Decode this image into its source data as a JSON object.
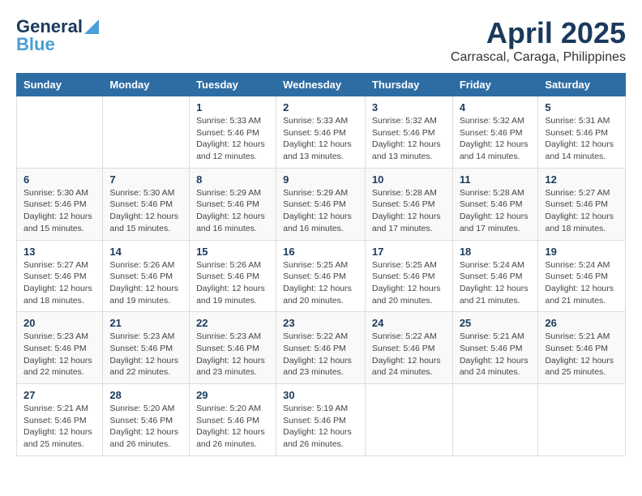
{
  "header": {
    "logo_line1": "General",
    "logo_line2": "Blue",
    "month": "April 2025",
    "location": "Carrascal, Caraga, Philippines"
  },
  "weekdays": [
    "Sunday",
    "Monday",
    "Tuesday",
    "Wednesday",
    "Thursday",
    "Friday",
    "Saturday"
  ],
  "weeks": [
    [
      {
        "day": "",
        "info": ""
      },
      {
        "day": "",
        "info": ""
      },
      {
        "day": "1",
        "info": "Sunrise: 5:33 AM\nSunset: 5:46 PM\nDaylight: 12 hours\nand 12 minutes."
      },
      {
        "day": "2",
        "info": "Sunrise: 5:33 AM\nSunset: 5:46 PM\nDaylight: 12 hours\nand 13 minutes."
      },
      {
        "day": "3",
        "info": "Sunrise: 5:32 AM\nSunset: 5:46 PM\nDaylight: 12 hours\nand 13 minutes."
      },
      {
        "day": "4",
        "info": "Sunrise: 5:32 AM\nSunset: 5:46 PM\nDaylight: 12 hours\nand 14 minutes."
      },
      {
        "day": "5",
        "info": "Sunrise: 5:31 AM\nSunset: 5:46 PM\nDaylight: 12 hours\nand 14 minutes."
      }
    ],
    [
      {
        "day": "6",
        "info": "Sunrise: 5:30 AM\nSunset: 5:46 PM\nDaylight: 12 hours\nand 15 minutes."
      },
      {
        "day": "7",
        "info": "Sunrise: 5:30 AM\nSunset: 5:46 PM\nDaylight: 12 hours\nand 15 minutes."
      },
      {
        "day": "8",
        "info": "Sunrise: 5:29 AM\nSunset: 5:46 PM\nDaylight: 12 hours\nand 16 minutes."
      },
      {
        "day": "9",
        "info": "Sunrise: 5:29 AM\nSunset: 5:46 PM\nDaylight: 12 hours\nand 16 minutes."
      },
      {
        "day": "10",
        "info": "Sunrise: 5:28 AM\nSunset: 5:46 PM\nDaylight: 12 hours\nand 17 minutes."
      },
      {
        "day": "11",
        "info": "Sunrise: 5:28 AM\nSunset: 5:46 PM\nDaylight: 12 hours\nand 17 minutes."
      },
      {
        "day": "12",
        "info": "Sunrise: 5:27 AM\nSunset: 5:46 PM\nDaylight: 12 hours\nand 18 minutes."
      }
    ],
    [
      {
        "day": "13",
        "info": "Sunrise: 5:27 AM\nSunset: 5:46 PM\nDaylight: 12 hours\nand 18 minutes."
      },
      {
        "day": "14",
        "info": "Sunrise: 5:26 AM\nSunset: 5:46 PM\nDaylight: 12 hours\nand 19 minutes."
      },
      {
        "day": "15",
        "info": "Sunrise: 5:26 AM\nSunset: 5:46 PM\nDaylight: 12 hours\nand 19 minutes."
      },
      {
        "day": "16",
        "info": "Sunrise: 5:25 AM\nSunset: 5:46 PM\nDaylight: 12 hours\nand 20 minutes."
      },
      {
        "day": "17",
        "info": "Sunrise: 5:25 AM\nSunset: 5:46 PM\nDaylight: 12 hours\nand 20 minutes."
      },
      {
        "day": "18",
        "info": "Sunrise: 5:24 AM\nSunset: 5:46 PM\nDaylight: 12 hours\nand 21 minutes."
      },
      {
        "day": "19",
        "info": "Sunrise: 5:24 AM\nSunset: 5:46 PM\nDaylight: 12 hours\nand 21 minutes."
      }
    ],
    [
      {
        "day": "20",
        "info": "Sunrise: 5:23 AM\nSunset: 5:46 PM\nDaylight: 12 hours\nand 22 minutes."
      },
      {
        "day": "21",
        "info": "Sunrise: 5:23 AM\nSunset: 5:46 PM\nDaylight: 12 hours\nand 22 minutes."
      },
      {
        "day": "22",
        "info": "Sunrise: 5:23 AM\nSunset: 5:46 PM\nDaylight: 12 hours\nand 23 minutes."
      },
      {
        "day": "23",
        "info": "Sunrise: 5:22 AM\nSunset: 5:46 PM\nDaylight: 12 hours\nand 23 minutes."
      },
      {
        "day": "24",
        "info": "Sunrise: 5:22 AM\nSunset: 5:46 PM\nDaylight: 12 hours\nand 24 minutes."
      },
      {
        "day": "25",
        "info": "Sunrise: 5:21 AM\nSunset: 5:46 PM\nDaylight: 12 hours\nand 24 minutes."
      },
      {
        "day": "26",
        "info": "Sunrise: 5:21 AM\nSunset: 5:46 PM\nDaylight: 12 hours\nand 25 minutes."
      }
    ],
    [
      {
        "day": "27",
        "info": "Sunrise: 5:21 AM\nSunset: 5:46 PM\nDaylight: 12 hours\nand 25 minutes."
      },
      {
        "day": "28",
        "info": "Sunrise: 5:20 AM\nSunset: 5:46 PM\nDaylight: 12 hours\nand 26 minutes."
      },
      {
        "day": "29",
        "info": "Sunrise: 5:20 AM\nSunset: 5:46 PM\nDaylight: 12 hours\nand 26 minutes."
      },
      {
        "day": "30",
        "info": "Sunrise: 5:19 AM\nSunset: 5:46 PM\nDaylight: 12 hours\nand 26 minutes."
      },
      {
        "day": "",
        "info": ""
      },
      {
        "day": "",
        "info": ""
      },
      {
        "day": "",
        "info": ""
      }
    ]
  ]
}
